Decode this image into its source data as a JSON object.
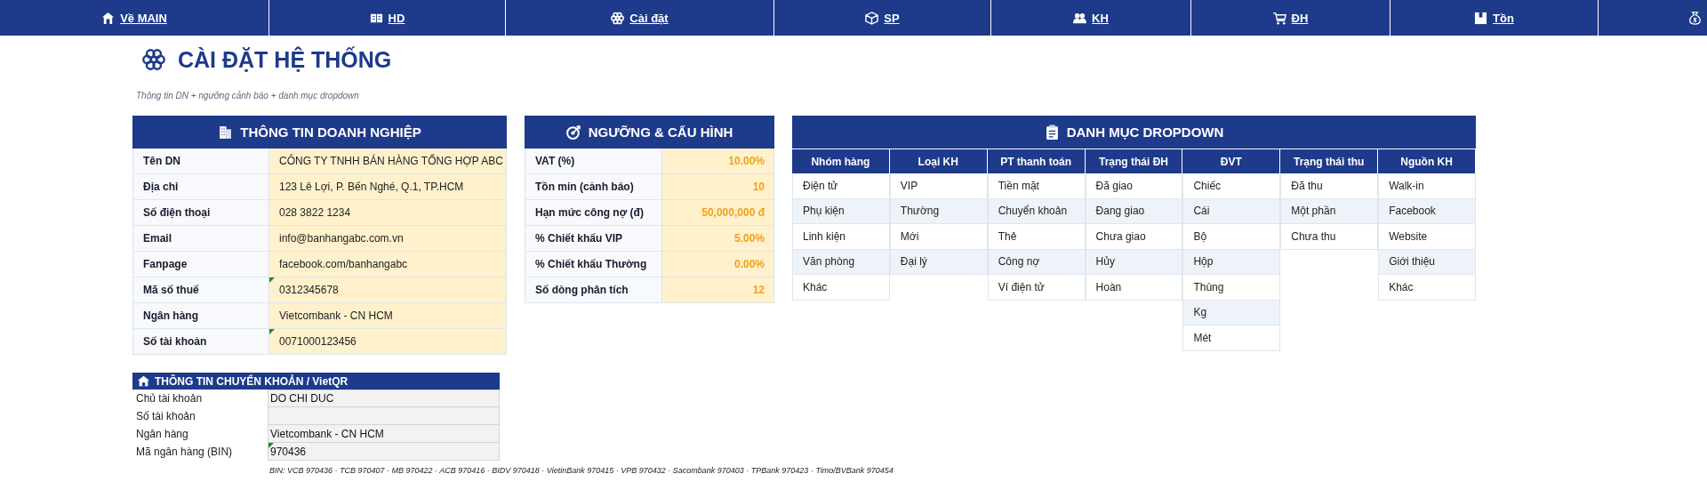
{
  "nav": [
    {
      "label": "Về MAIN"
    },
    {
      "label": "HD"
    },
    {
      "label": "Cài đặt"
    },
    {
      "label": "SP"
    },
    {
      "label": "KH"
    },
    {
      "label": "ĐH"
    },
    {
      "label": "Tồn"
    }
  ],
  "page": {
    "title": "CÀI ĐẶT HỆ THỐNG",
    "subtitle": "Thông tin DN + ngưỡng cảnh báo + danh mục dropdown"
  },
  "company": {
    "title": "THÔNG TIN DOANH NGHIỆP",
    "rows": [
      {
        "label": "Tên DN",
        "value": "CÔNG TY TNHH BÁN HÀNG TỔNG HỢP ABC",
        "flagged": false
      },
      {
        "label": "Địa chỉ",
        "value": "123 Lê Lợi, P. Bến Nghé, Q.1, TP.HCM",
        "flagged": false
      },
      {
        "label": "Số điện thoại",
        "value": "028 3822 1234",
        "flagged": false
      },
      {
        "label": "Email",
        "value": "info@banhangabc.com.vn",
        "flagged": false
      },
      {
        "label": "Fanpage",
        "value": "facebook.com/banhangabc",
        "flagged": false
      },
      {
        "label": "Mã số thuế",
        "value": "0312345678",
        "flagged": true
      },
      {
        "label": "Ngân hàng",
        "value": "Vietcombank - CN HCM",
        "flagged": false
      },
      {
        "label": "Số tài khoản",
        "value": "0071000123456",
        "flagged": true
      }
    ]
  },
  "thresholds": {
    "title": "NGƯỠNG & CẤU HÌNH",
    "rows": [
      {
        "label": "VAT (%)",
        "value": "10.00%"
      },
      {
        "label": "Tồn min (cảnh báo)",
        "value": "10"
      },
      {
        "label": "Hạn mức công nợ (đ)",
        "value": "50,000,000 đ"
      },
      {
        "label": "% Chiết khấu VIP",
        "value": "5.00%"
      },
      {
        "label": "% Chiết khấu Thường",
        "value": "0.00%"
      },
      {
        "label": "Số dòng phân tích",
        "value": "12"
      }
    ]
  },
  "dropdowns": {
    "title": "DANH MỤC DROPDOWN",
    "columns": [
      {
        "header": "Nhóm hàng",
        "items": [
          "Điện tử",
          "Phụ kiện",
          "Linh kiện",
          "Văn phòng",
          "Khác"
        ]
      },
      {
        "header": "Loại KH",
        "items": [
          "VIP",
          "Thường",
          "Mới",
          "Đại lý"
        ]
      },
      {
        "header": "PT thanh toán",
        "items": [
          "Tiền mặt",
          "Chuyển khoản",
          "Thẻ",
          "Công nợ",
          "Ví điện tử"
        ]
      },
      {
        "header": "Trạng thái ĐH",
        "items": [
          "Đã giao",
          "Đang giao",
          "Chưa giao",
          "Hủy",
          "Hoàn"
        ]
      },
      {
        "header": "ĐVT",
        "items": [
          "Chiếc",
          "Cái",
          "Bộ",
          "Hộp",
          "Thùng",
          "Kg",
          "Mét"
        ]
      },
      {
        "header": "Trạng thái thu",
        "items": [
          "Đã thu",
          "Một phần",
          "Chưa thu"
        ]
      },
      {
        "header": "Nguồn KH",
        "items": [
          "Walk-in",
          "Facebook",
          "Website",
          "Giới thiệu",
          "Khác"
        ]
      }
    ]
  },
  "transfer": {
    "title": "THÔNG TIN CHUYỂN KHOẢN / VietQR",
    "rows": [
      {
        "label": "Chủ tài khoản",
        "value": "DO CHI DUC",
        "flagged": false
      },
      {
        "label": "Số tài khoản",
        "flagged": false
      },
      {
        "label": "Ngân hàng",
        "value": "Vietcombank - CN HCM",
        "flagged": false
      },
      {
        "label": "Mã ngân hàng (BIN)",
        "value": "970436",
        "flagged": true
      }
    ],
    "note": "BIN: VCB 970436 · TCB 970407 · MB 970422 · ACB 970416 · BIDV 970418 · VietinBank 970415 · VPB 970432 · Sacombank 970403 · TPBank 970423 · Timo/BVBank 970454"
  }
}
